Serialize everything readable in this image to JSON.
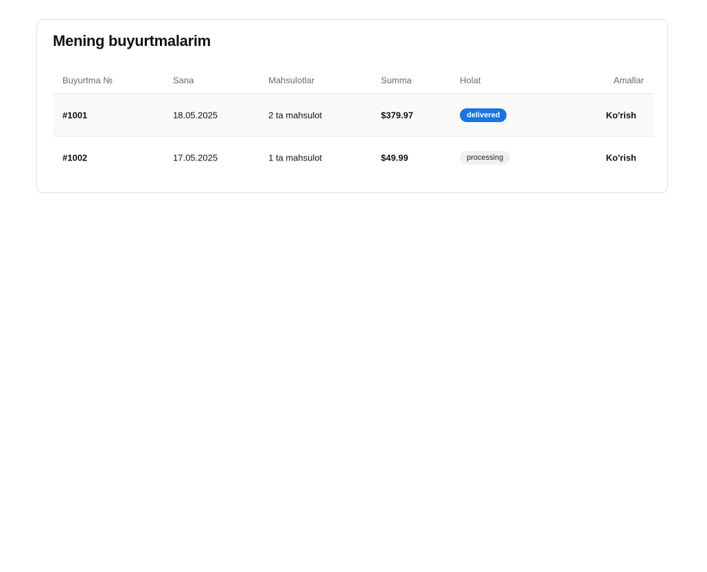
{
  "page": {
    "title": "Mening buyurtmalarim"
  },
  "table": {
    "headers": {
      "id": "Buyurtma №",
      "date": "Sana",
      "items": "Mahsulotlar",
      "sum": "Summa",
      "status": "Holat",
      "actions": "Amallar"
    },
    "rows": [
      {
        "id": "#1001",
        "date": "18.05.2025",
        "items": "2 ta mahsulot",
        "sum": "$379.97",
        "status": "delivered",
        "action": "Ko'rish"
      },
      {
        "id": "#1002",
        "date": "17.05.2025",
        "items": "1 ta mahsulot",
        "sum": "$49.99",
        "status": "processing",
        "action": "Ko'rish"
      }
    ]
  },
  "colors": {
    "delivered_badge": "#1a73e8",
    "processing_badge": "#f0f0f0",
    "row_highlight": "#f9f9f8"
  }
}
